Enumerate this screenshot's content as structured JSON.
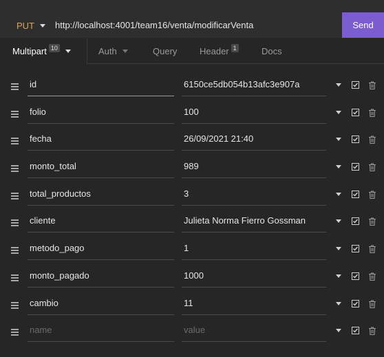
{
  "request": {
    "method": "PUT",
    "url": "http://localhost:4001/team16/venta/modificarVenta",
    "send_label": "Send"
  },
  "tabs": [
    {
      "label": "Multipart",
      "badge": "10"
    },
    {
      "label": "Auth"
    },
    {
      "label": "Query"
    },
    {
      "label": "Header",
      "badge": "1"
    },
    {
      "label": "Docs"
    }
  ],
  "params": [
    {
      "name": "id",
      "value": "6150ce5db054b13afc3e907a"
    },
    {
      "name": "folio",
      "value": "100"
    },
    {
      "name": "fecha",
      "value": "26/09/2021 21:40"
    },
    {
      "name": "monto_total",
      "value": "989"
    },
    {
      "name": "total_productos",
      "value": "3"
    },
    {
      "name": "cliente",
      "value": "Julieta Norma Fierro Gossman"
    },
    {
      "name": "metodo_pago",
      "value": "1"
    },
    {
      "name": "monto_pagado",
      "value": "1000"
    },
    {
      "name": "cambio",
      "value": "11"
    }
  ],
  "new_param": {
    "name_placeholder": "name",
    "value_placeholder": "value"
  },
  "colors": {
    "accent": "#7b5dd0",
    "method": "#e0a35a"
  }
}
